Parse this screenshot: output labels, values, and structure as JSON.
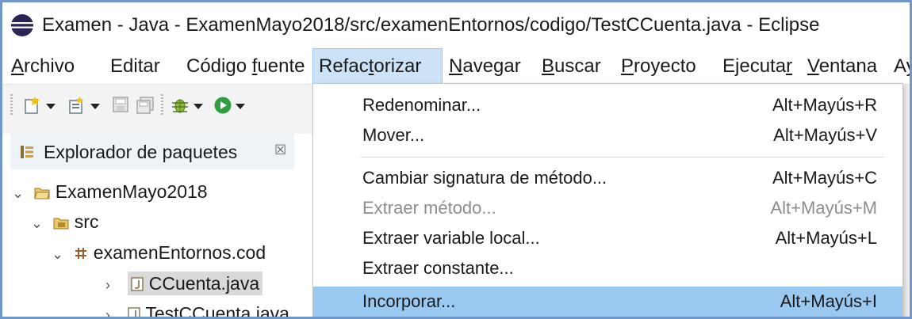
{
  "window": {
    "title": "Examen - Java - ExamenMayo2018/src/examenEntornos/codigo/TestCCuenta.java - Eclipse",
    "app_icon": "eclipse-icon"
  },
  "menubar": {
    "items": [
      {
        "pre": "",
        "key": "A",
        "post": "rchivo"
      },
      {
        "pre": "Editar",
        "key": "",
        "post": ""
      },
      {
        "pre": "Código ",
        "key": "f",
        "post": "uente"
      },
      {
        "pre": "Refac",
        "key": "t",
        "post": "orizar"
      },
      {
        "pre": "",
        "key": "N",
        "post": "avegar"
      },
      {
        "pre": "",
        "key": "B",
        "post": "uscar"
      },
      {
        "pre": "",
        "key": "P",
        "post": "royecto"
      },
      {
        "pre": "Ejecuta",
        "key": "r",
        "post": ""
      },
      {
        "pre": "",
        "key": "V",
        "post": "entana"
      },
      {
        "pre": "Ay",
        "key": "",
        "post": ""
      }
    ]
  },
  "toolbar": {
    "icons": [
      "new-icon",
      "new-wizard-icon",
      "save-icon",
      "save-all-icon",
      "debug-icon",
      "run-icon"
    ]
  },
  "package_explorer": {
    "title": "Explorador de paquetes",
    "close_glyph": "☒",
    "tree": [
      {
        "label": "ExamenMayo2018",
        "icon": "project-folder-icon",
        "chevron": "⌄"
      },
      {
        "label": "src",
        "icon": "source-folder-icon",
        "chevron": "⌄"
      },
      {
        "label": "examenEntornos.cod",
        "icon": "package-icon",
        "chevron": "⌄"
      },
      {
        "label": "CCuenta.java",
        "icon": "java-file-icon",
        "chevron": "›"
      },
      {
        "label": "TestCCuenta.java",
        "icon": "java-file-icon",
        "chevron": "›"
      }
    ]
  },
  "refactor_menu": {
    "items": [
      {
        "label": "Redenominar...",
        "shortcut": "Alt+Mayús+R",
        "enabled": true,
        "highlighted": false
      },
      {
        "label": "Mover...",
        "shortcut": "Alt+Mayús+V",
        "enabled": true,
        "highlighted": false
      },
      {
        "label": "Cambiar signatura de método...",
        "shortcut": "Alt+Mayús+C",
        "enabled": true,
        "highlighted": false
      },
      {
        "label": "Extraer método...",
        "shortcut": "Alt+Mayús+M",
        "enabled": false,
        "highlighted": false
      },
      {
        "label": "Extraer variable local...",
        "shortcut": "Alt+Mayús+L",
        "enabled": true,
        "highlighted": false
      },
      {
        "label": "Extraer constante...",
        "shortcut": "",
        "enabled": true,
        "highlighted": false
      },
      {
        "label": "Incorporar...",
        "shortcut": "Alt+Mayús+I",
        "enabled": true,
        "highlighted": true
      }
    ]
  },
  "colors": {
    "highlight": "#99c9f1",
    "active_menu": "#cce3f7",
    "window_border": "#6f98c8",
    "disabled_text": "#8d8d8d"
  }
}
